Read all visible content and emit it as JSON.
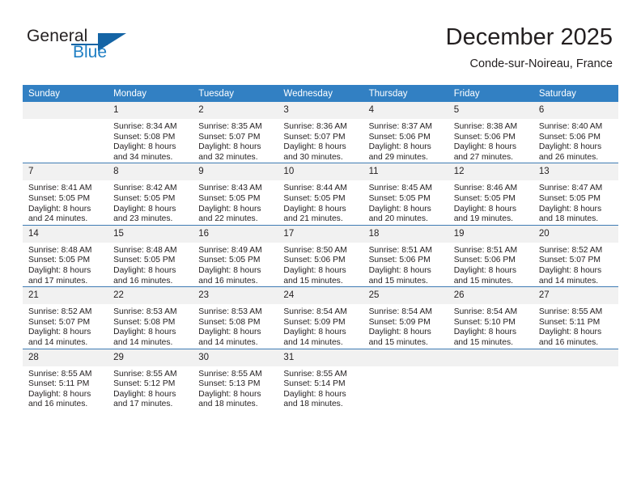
{
  "brand": {
    "name_part1": "General",
    "name_part2": "Blue",
    "logo_icon": "triangle-logo-icon"
  },
  "header": {
    "month_title": "December 2025",
    "location": "Conde-sur-Noireau, France"
  },
  "calendar": {
    "weekday_headers": [
      "Sunday",
      "Monday",
      "Tuesday",
      "Wednesday",
      "Thursday",
      "Friday",
      "Saturday"
    ],
    "accent_color": "#3280c3",
    "daynum_bg": "#f1f1f1",
    "weeks": [
      [
        {
          "day": "",
          "sunrise": "",
          "sunset": "",
          "daylight_line1": "",
          "daylight_line2": ""
        },
        {
          "day": "1",
          "sunrise": "Sunrise: 8:34 AM",
          "sunset": "Sunset: 5:08 PM",
          "daylight_line1": "Daylight: 8 hours",
          "daylight_line2": "and 34 minutes."
        },
        {
          "day": "2",
          "sunrise": "Sunrise: 8:35 AM",
          "sunset": "Sunset: 5:07 PM",
          "daylight_line1": "Daylight: 8 hours",
          "daylight_line2": "and 32 minutes."
        },
        {
          "day": "3",
          "sunrise": "Sunrise: 8:36 AM",
          "sunset": "Sunset: 5:07 PM",
          "daylight_line1": "Daylight: 8 hours",
          "daylight_line2": "and 30 minutes."
        },
        {
          "day": "4",
          "sunrise": "Sunrise: 8:37 AM",
          "sunset": "Sunset: 5:06 PM",
          "daylight_line1": "Daylight: 8 hours",
          "daylight_line2": "and 29 minutes."
        },
        {
          "day": "5",
          "sunrise": "Sunrise: 8:38 AM",
          "sunset": "Sunset: 5:06 PM",
          "daylight_line1": "Daylight: 8 hours",
          "daylight_line2": "and 27 minutes."
        },
        {
          "day": "6",
          "sunrise": "Sunrise: 8:40 AM",
          "sunset": "Sunset: 5:06 PM",
          "daylight_line1": "Daylight: 8 hours",
          "daylight_line2": "and 26 minutes."
        }
      ],
      [
        {
          "day": "7",
          "sunrise": "Sunrise: 8:41 AM",
          "sunset": "Sunset: 5:05 PM",
          "daylight_line1": "Daylight: 8 hours",
          "daylight_line2": "and 24 minutes."
        },
        {
          "day": "8",
          "sunrise": "Sunrise: 8:42 AM",
          "sunset": "Sunset: 5:05 PM",
          "daylight_line1": "Daylight: 8 hours",
          "daylight_line2": "and 23 minutes."
        },
        {
          "day": "9",
          "sunrise": "Sunrise: 8:43 AM",
          "sunset": "Sunset: 5:05 PM",
          "daylight_line1": "Daylight: 8 hours",
          "daylight_line2": "and 22 minutes."
        },
        {
          "day": "10",
          "sunrise": "Sunrise: 8:44 AM",
          "sunset": "Sunset: 5:05 PM",
          "daylight_line1": "Daylight: 8 hours",
          "daylight_line2": "and 21 minutes."
        },
        {
          "day": "11",
          "sunrise": "Sunrise: 8:45 AM",
          "sunset": "Sunset: 5:05 PM",
          "daylight_line1": "Daylight: 8 hours",
          "daylight_line2": "and 20 minutes."
        },
        {
          "day": "12",
          "sunrise": "Sunrise: 8:46 AM",
          "sunset": "Sunset: 5:05 PM",
          "daylight_line1": "Daylight: 8 hours",
          "daylight_line2": "and 19 minutes."
        },
        {
          "day": "13",
          "sunrise": "Sunrise: 8:47 AM",
          "sunset": "Sunset: 5:05 PM",
          "daylight_line1": "Daylight: 8 hours",
          "daylight_line2": "and 18 minutes."
        }
      ],
      [
        {
          "day": "14",
          "sunrise": "Sunrise: 8:48 AM",
          "sunset": "Sunset: 5:05 PM",
          "daylight_line1": "Daylight: 8 hours",
          "daylight_line2": "and 17 minutes."
        },
        {
          "day": "15",
          "sunrise": "Sunrise: 8:48 AM",
          "sunset": "Sunset: 5:05 PM",
          "daylight_line1": "Daylight: 8 hours",
          "daylight_line2": "and 16 minutes."
        },
        {
          "day": "16",
          "sunrise": "Sunrise: 8:49 AM",
          "sunset": "Sunset: 5:05 PM",
          "daylight_line1": "Daylight: 8 hours",
          "daylight_line2": "and 16 minutes."
        },
        {
          "day": "17",
          "sunrise": "Sunrise: 8:50 AM",
          "sunset": "Sunset: 5:06 PM",
          "daylight_line1": "Daylight: 8 hours",
          "daylight_line2": "and 15 minutes."
        },
        {
          "day": "18",
          "sunrise": "Sunrise: 8:51 AM",
          "sunset": "Sunset: 5:06 PM",
          "daylight_line1": "Daylight: 8 hours",
          "daylight_line2": "and 15 minutes."
        },
        {
          "day": "19",
          "sunrise": "Sunrise: 8:51 AM",
          "sunset": "Sunset: 5:06 PM",
          "daylight_line1": "Daylight: 8 hours",
          "daylight_line2": "and 15 minutes."
        },
        {
          "day": "20",
          "sunrise": "Sunrise: 8:52 AM",
          "sunset": "Sunset: 5:07 PM",
          "daylight_line1": "Daylight: 8 hours",
          "daylight_line2": "and 14 minutes."
        }
      ],
      [
        {
          "day": "21",
          "sunrise": "Sunrise: 8:52 AM",
          "sunset": "Sunset: 5:07 PM",
          "daylight_line1": "Daylight: 8 hours",
          "daylight_line2": "and 14 minutes."
        },
        {
          "day": "22",
          "sunrise": "Sunrise: 8:53 AM",
          "sunset": "Sunset: 5:08 PM",
          "daylight_line1": "Daylight: 8 hours",
          "daylight_line2": "and 14 minutes."
        },
        {
          "day": "23",
          "sunrise": "Sunrise: 8:53 AM",
          "sunset": "Sunset: 5:08 PM",
          "daylight_line1": "Daylight: 8 hours",
          "daylight_line2": "and 14 minutes."
        },
        {
          "day": "24",
          "sunrise": "Sunrise: 8:54 AM",
          "sunset": "Sunset: 5:09 PM",
          "daylight_line1": "Daylight: 8 hours",
          "daylight_line2": "and 14 minutes."
        },
        {
          "day": "25",
          "sunrise": "Sunrise: 8:54 AM",
          "sunset": "Sunset: 5:09 PM",
          "daylight_line1": "Daylight: 8 hours",
          "daylight_line2": "and 15 minutes."
        },
        {
          "day": "26",
          "sunrise": "Sunrise: 8:54 AM",
          "sunset": "Sunset: 5:10 PM",
          "daylight_line1": "Daylight: 8 hours",
          "daylight_line2": "and 15 minutes."
        },
        {
          "day": "27",
          "sunrise": "Sunrise: 8:55 AM",
          "sunset": "Sunset: 5:11 PM",
          "daylight_line1": "Daylight: 8 hours",
          "daylight_line2": "and 16 minutes."
        }
      ],
      [
        {
          "day": "28",
          "sunrise": "Sunrise: 8:55 AM",
          "sunset": "Sunset: 5:11 PM",
          "daylight_line1": "Daylight: 8 hours",
          "daylight_line2": "and 16 minutes."
        },
        {
          "day": "29",
          "sunrise": "Sunrise: 8:55 AM",
          "sunset": "Sunset: 5:12 PM",
          "daylight_line1": "Daylight: 8 hours",
          "daylight_line2": "and 17 minutes."
        },
        {
          "day": "30",
          "sunrise": "Sunrise: 8:55 AM",
          "sunset": "Sunset: 5:13 PM",
          "daylight_line1": "Daylight: 8 hours",
          "daylight_line2": "and 18 minutes."
        },
        {
          "day": "31",
          "sunrise": "Sunrise: 8:55 AM",
          "sunset": "Sunset: 5:14 PM",
          "daylight_line1": "Daylight: 8 hours",
          "daylight_line2": "and 18 minutes."
        },
        {
          "day": "",
          "sunrise": "",
          "sunset": "",
          "daylight_line1": "",
          "daylight_line2": ""
        },
        {
          "day": "",
          "sunrise": "",
          "sunset": "",
          "daylight_line1": "",
          "daylight_line2": ""
        },
        {
          "day": "",
          "sunrise": "",
          "sunset": "",
          "daylight_line1": "",
          "daylight_line2": ""
        }
      ]
    ]
  }
}
